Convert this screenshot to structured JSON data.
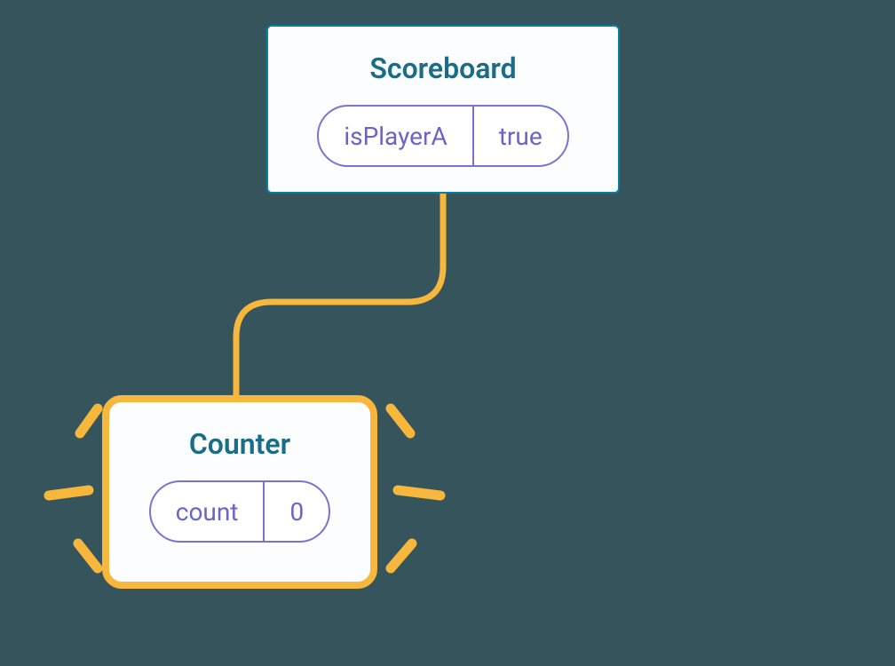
{
  "parent": {
    "title": "Scoreboard",
    "state_key": "isPlayerA",
    "state_value": "true"
  },
  "child": {
    "title": "Counter",
    "state_key": "count",
    "state_value": "0"
  },
  "colors": {
    "background": "#35545b",
    "parent_border": "#087ea4",
    "child_border": "#f6b73c",
    "connector": "#f6b73c",
    "pill_border": "#7a73d1",
    "pill_text": "#6b64c8",
    "title_text": "#1a6d86"
  }
}
